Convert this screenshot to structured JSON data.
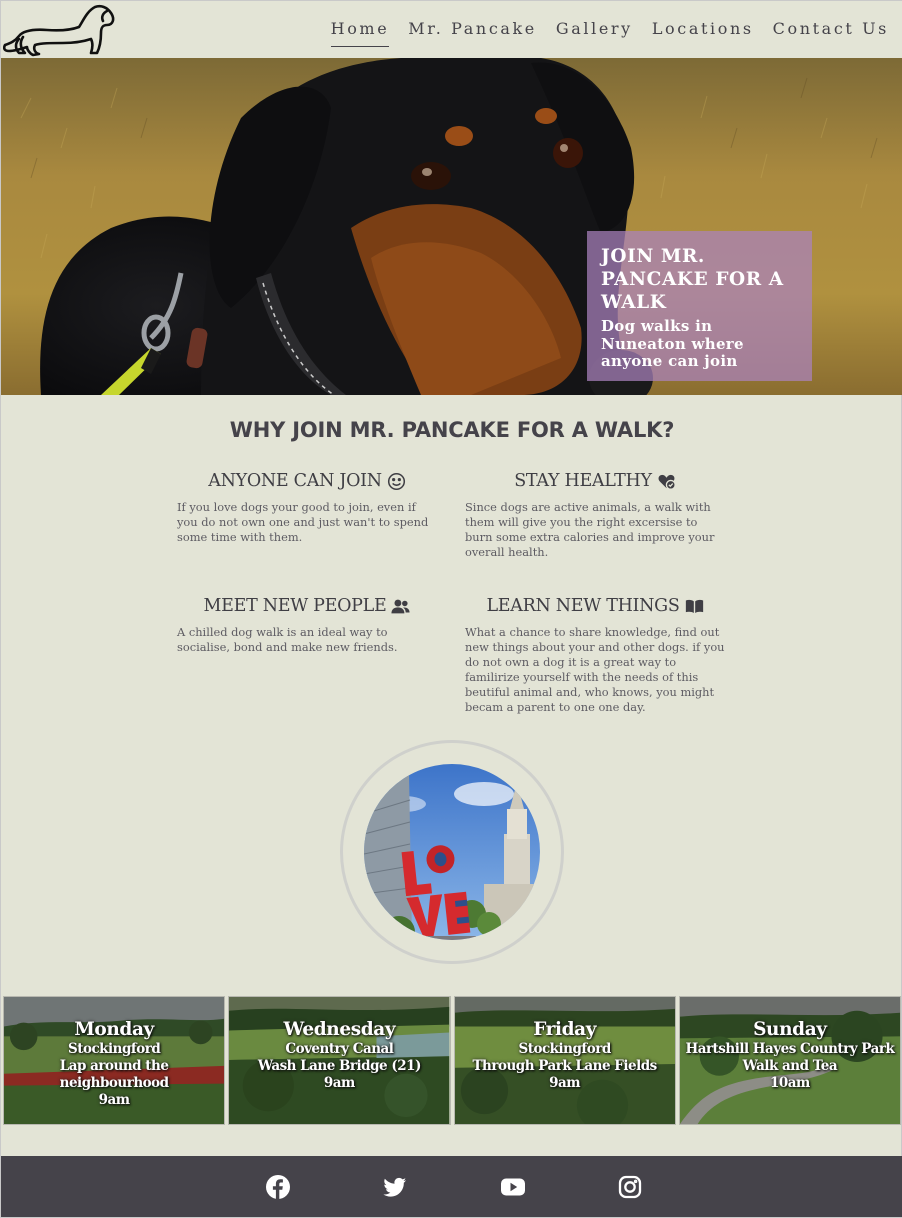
{
  "header": {
    "logo_icon": "dachshund-logo-icon",
    "nav": [
      {
        "label": "Home",
        "active": true
      },
      {
        "label": "Mr. Pancake",
        "active": false
      },
      {
        "label": "Gallery",
        "active": false
      },
      {
        "label": "Locations",
        "active": false
      },
      {
        "label": "Contact Us",
        "active": false
      }
    ]
  },
  "hero": {
    "title": "JOIN MR. PANCAKE FOR A WALK",
    "subtitle": "Dog walks in Nuneaton where anyone can join",
    "box_color": "#aa82be"
  },
  "why": {
    "title": "WHY JOIN MR. PANCAKE FOR A WALK?",
    "features": [
      {
        "title": "ANYONE CAN JOIN",
        "icon": "smile-icon",
        "text": "If you love dogs your good to join, even if you do not own one and just wan't to spend some time with them."
      },
      {
        "title": "STAY HEALTHY",
        "icon": "heart-check-icon",
        "text": "Since dogs are active animals, a walk with them will give you the right excersise to burn some extra calories and improve your overall health."
      },
      {
        "title": "MEET NEW PEOPLE",
        "icon": "users-icon",
        "text": "A chilled dog walk is an ideal way to socialise, bond and make new friends."
      },
      {
        "title": "LEARN NEW THINGS",
        "icon": "book-open-icon",
        "text": "What a chance to share knowledge, find out new things about your and other dogs. if you do not own a dog it is a great way to familirize yourself with the needs of this beutiful animal and, who knows, you might becam a parent to one one day."
      }
    ]
  },
  "schedule": [
    {
      "day": "Monday",
      "place": "Stockingford",
      "detail": "Lap around the neighbourhood",
      "time": "9am"
    },
    {
      "day": "Wednesday",
      "place": "Coventry Canal",
      "detail": "Wash Lane Bridge (21)",
      "time": "9am"
    },
    {
      "day": "Friday",
      "place": "Stockingford",
      "detail": "Through Park Lane Fields",
      "time": "9am"
    },
    {
      "day": "Sunday",
      "place": "Hartshill Hayes Country Park",
      "detail": "Walk and Tea",
      "time": "10am"
    }
  ],
  "footer": {
    "social": [
      "facebook-icon",
      "twitter-icon",
      "youtube-icon",
      "instagram-icon"
    ],
    "background": "#45434a"
  }
}
